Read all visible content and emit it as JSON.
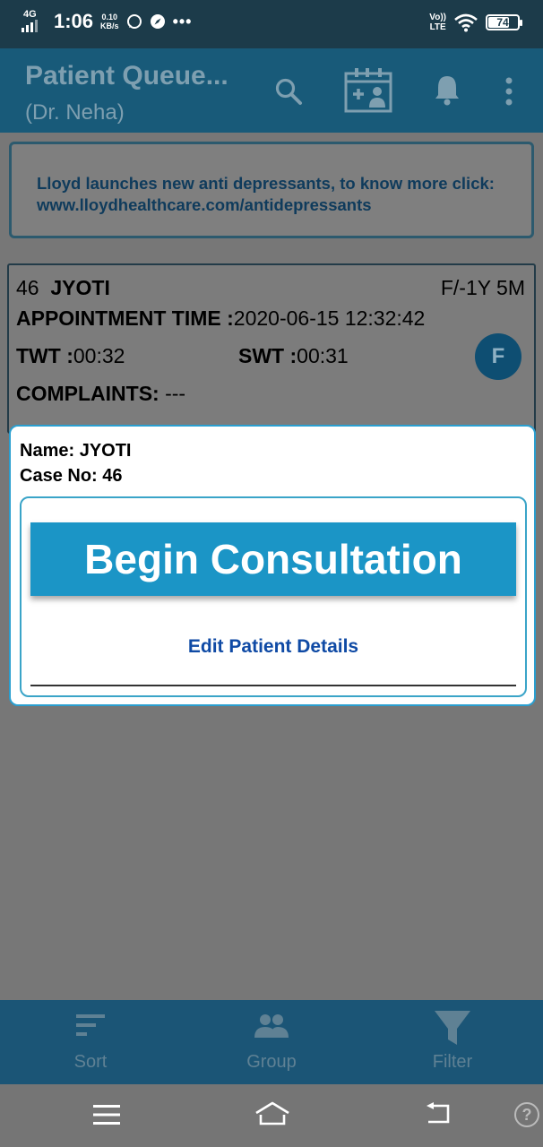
{
  "status_bar": {
    "network": "4G",
    "time": "1:06",
    "speed_value": "0.10",
    "speed_unit": "KB/s",
    "overflow": "•••",
    "volte_top": "Vo))",
    "volte_bottom": "LTE",
    "battery_level": "74",
    "battery_fraction": 0.74
  },
  "app_bar": {
    "title": "Patient Queue...",
    "subtitle": "(Dr. Neha)",
    "icons": [
      "search-icon",
      "calendar-add-patient-icon",
      "bell-icon",
      "more-vert-icon"
    ]
  },
  "banner": {
    "line1": "Lloyd launches new anti depressants, to know more click:",
    "line2": "www.lloydhealthcare.com/antidepressants"
  },
  "patient_card": {
    "token": "46",
    "name": "JYOTI",
    "gender_age": "F/-1Y 5M",
    "appointment_label": "APPOINTMENT TIME :",
    "appointment_value": "2020-06-15 12:32:42",
    "twt_label": "TWT :",
    "twt_value": "00:32",
    "swt_label": "SWT :",
    "swt_value": "00:31",
    "complaints_label": "COMPLAINTS:",
    "complaints_value": " ---",
    "avatar_letter": "F"
  },
  "dialog": {
    "name_line": "Name: JYOTI",
    "case_line": "Case No: 46",
    "begin_label": "Begin Consultation",
    "edit_label": "Edit Patient Details"
  },
  "bottom_nav": {
    "items": [
      {
        "label": "Sort",
        "icon": "sort-icon"
      },
      {
        "label": "Group",
        "icon": "group-icon"
      },
      {
        "label": "Filter",
        "icon": "filter-icon"
      }
    ]
  },
  "system_nav": {
    "icons": [
      "menu-icon",
      "home-icon",
      "back-icon",
      "help-icon"
    ],
    "help_glyph": "?"
  }
}
